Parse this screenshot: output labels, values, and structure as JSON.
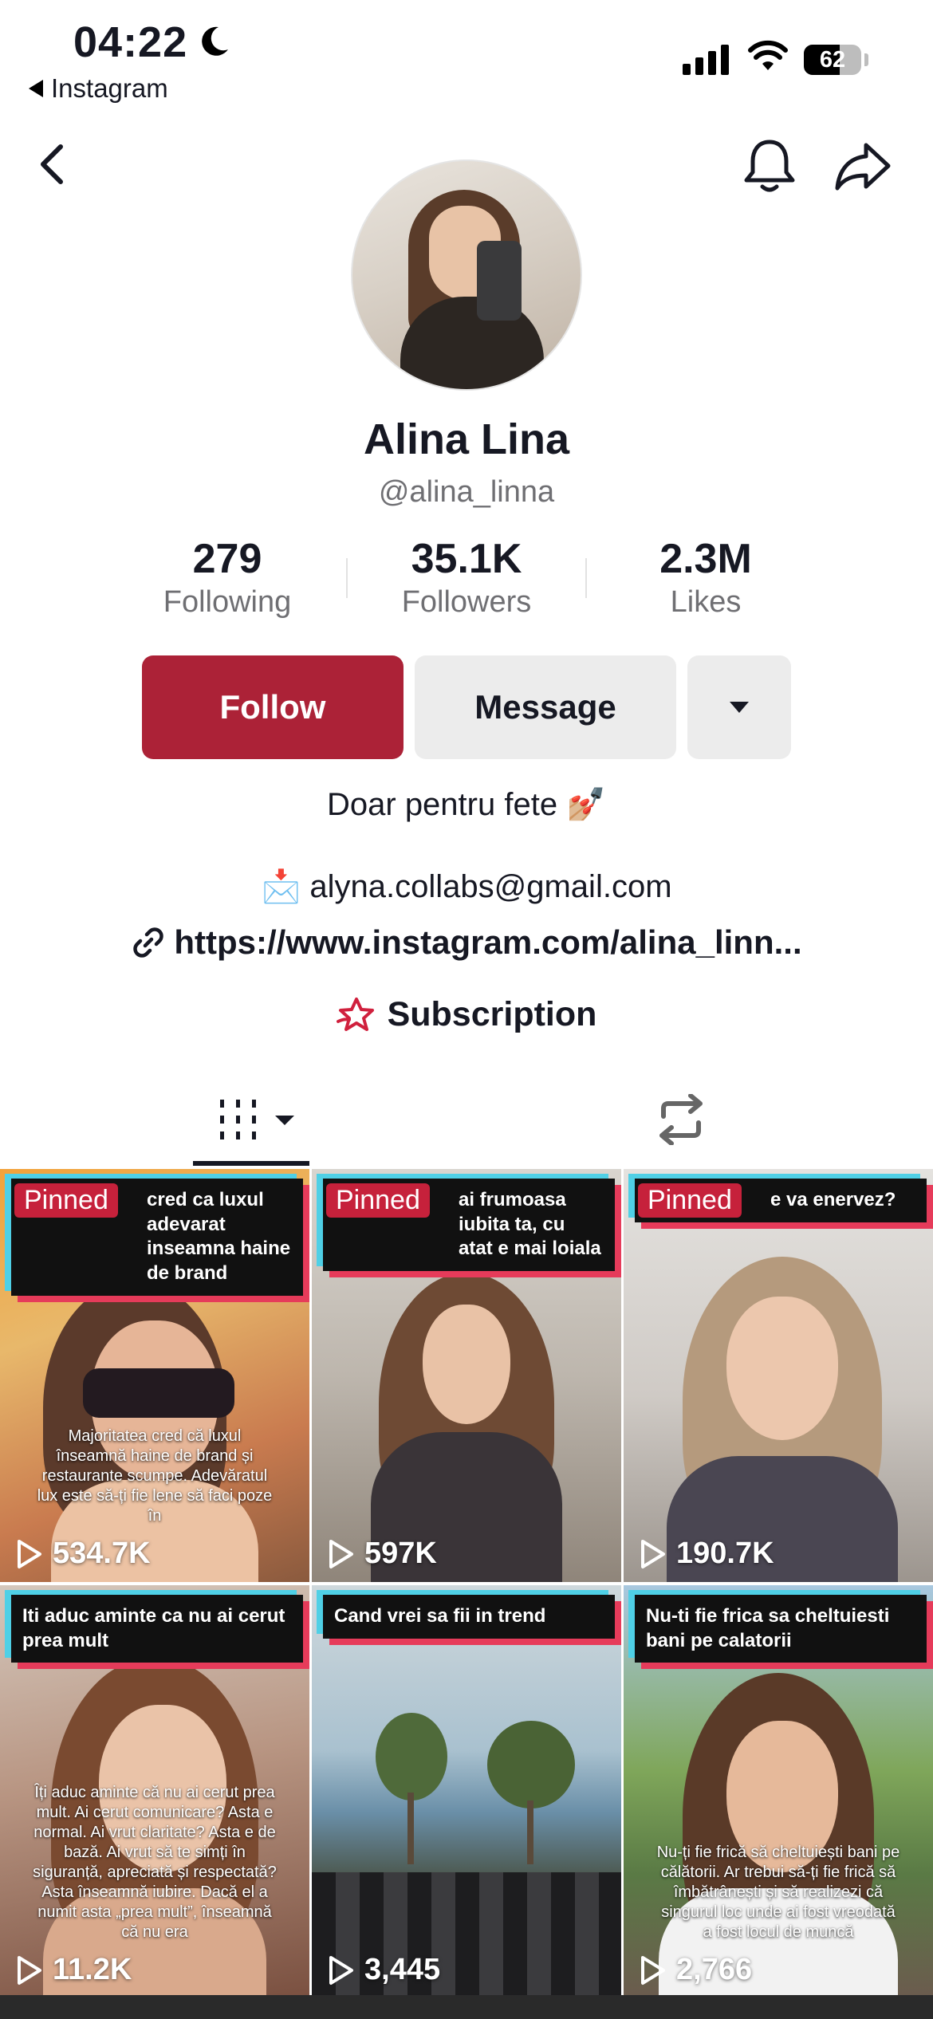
{
  "status_bar": {
    "time": "04:22",
    "back_app": "Instagram",
    "battery": "62",
    "battery_level": 0.62
  },
  "profile": {
    "name": "Alina Lina",
    "handle": "@alina_linna",
    "stats": [
      {
        "value": "279",
        "label": "Following"
      },
      {
        "value": "35.1K",
        "label": "Followers"
      },
      {
        "value": "2.3M",
        "label": "Likes"
      }
    ],
    "follow_label": "Follow",
    "message_label": "Message",
    "bio": "Doar pentru fete 💅🏼",
    "email": "📩 alyna.collabs@gmail.com",
    "link": "https://www.instagram.com/alina_linn...",
    "subscription": "Subscription"
  },
  "colors": {
    "follow": "#ac2237",
    "pinned": "#c6213b",
    "caption_shadow_red": "#e63b5a",
    "caption_shadow_cyan": "#4fd0e6"
  },
  "videos": [
    {
      "pinned": "Pinned",
      "caption": "cred ca luxul adevarat inseamna haine de brand",
      "sub": "Majoritatea cred că luxul înseamnă haine de brand și restaurante scumpe. Adevăratul lux este să-ți fie lene să faci poze în",
      "views": "534.7K"
    },
    {
      "pinned": "Pinned",
      "caption": "ai frumoasa iubita ta, cu atat e mai loiala",
      "sub": "",
      "views": "597K"
    },
    {
      "pinned": "Pinned",
      "caption": "e va enervez?",
      "sub": "",
      "views": "190.7K"
    },
    {
      "pinned": "",
      "caption": "Iti aduc aminte ca nu ai cerut prea mult",
      "sub": "Îți aduc aminte că nu ai cerut prea mult. Ai cerut comunicare? Asta e normal. Ai vrut claritate? Asta e de bază. Ai vrut să te simți în siguranță, apreciată și respectată? Asta înseamnă iubire. Dacă el a numit asta „prea mult”, înseamnă că nu era",
      "views": "11.2K"
    },
    {
      "pinned": "",
      "caption": "Cand vrei sa fii in trend",
      "sub": "",
      "views": "3,445"
    },
    {
      "pinned": "",
      "caption": "Nu-ti fie frica sa cheltuiesti bani pe calatorii",
      "sub": "Nu-ți fie frică să cheltuiești bani pe călătorii. Ar trebui să-ți fie frică să îmbătrânești și să realizezi că singurul loc unde ai fost vreodată a fost locul de muncă",
      "views": "2,766"
    }
  ]
}
